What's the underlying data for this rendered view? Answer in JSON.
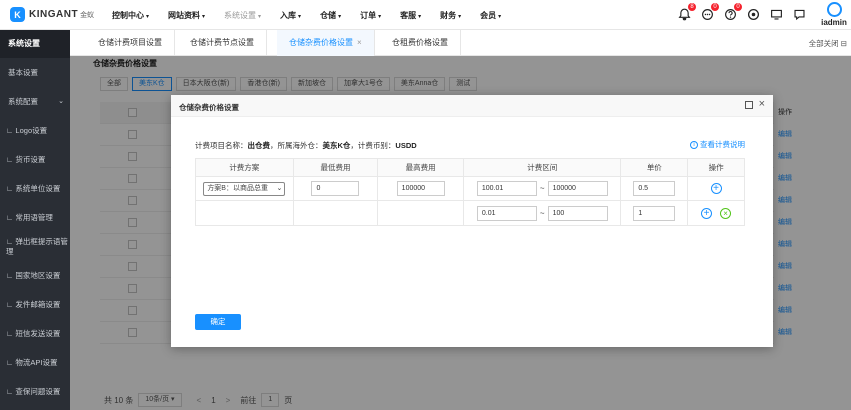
{
  "app": {
    "logo_mark": "K",
    "logo_text": "KINGANT",
    "logo_sub": "金蚁",
    "user_name": "iadmin"
  },
  "topnav": [
    {
      "label": "控制中心",
      "caret": "▾",
      "muted": false
    },
    {
      "label": "网站资料",
      "caret": "▾",
      "muted": false
    },
    {
      "label": "系统设置",
      "caret": "▾",
      "muted": true
    },
    {
      "label": "入库",
      "caret": "▾",
      "muted": false
    },
    {
      "label": "仓储",
      "caret": "▾",
      "muted": false
    },
    {
      "label": "订单",
      "caret": "▾",
      "muted": false
    },
    {
      "label": "客服",
      "caret": "▾",
      "muted": false
    },
    {
      "label": "财务",
      "caret": "▾",
      "muted": false
    },
    {
      "label": "会员",
      "caret": "▾",
      "muted": false
    }
  ],
  "top_icons": [
    {
      "name": "bell-icon",
      "badge": "8"
    },
    {
      "name": "message-icon",
      "badge": "0"
    },
    {
      "name": "help-icon",
      "badge": "0"
    },
    {
      "name": "target-icon",
      "badge": ""
    },
    {
      "name": "monitor-icon",
      "badge": ""
    },
    {
      "name": "chat-icon",
      "badge": ""
    }
  ],
  "sidebar": {
    "header": "系统设置",
    "items": [
      {
        "label": "基本设置",
        "sub": false
      },
      {
        "label": "系统配置",
        "sub": false,
        "arrow": "⌄"
      },
      {
        "label": "∟ Logo设置",
        "sub": true
      },
      {
        "label": "∟ 货币设置",
        "sub": true
      },
      {
        "label": "∟ 系统单位设置",
        "sub": true
      },
      {
        "label": "∟ 常用语管理",
        "sub": true
      },
      {
        "label": "∟ 弹出框提示语管理",
        "sub": true
      },
      {
        "label": "∟ 国家地区设置",
        "sub": true
      },
      {
        "label": "∟ 发件邮箱设置",
        "sub": true
      },
      {
        "label": "∟ 短信发送设置",
        "sub": true
      },
      {
        "label": "∟ 物流API设置",
        "sub": true
      },
      {
        "label": "∟ 查保问题设置",
        "sub": true
      }
    ]
  },
  "tabs": [
    {
      "label": "仓储计费项目设置",
      "active": false
    },
    {
      "label": "仓储计费节点设置",
      "active": false
    },
    {
      "label": "仓储杂费价格设置",
      "active": true,
      "close": "×"
    },
    {
      "label": "仓租费价格设置",
      "active": false
    }
  ],
  "close_all": "全部关闭 ⊟",
  "content": {
    "title": "仓储杂费价格设置",
    "warehouse_tabs": [
      "全部",
      "美东K仓",
      "日本大阪仓(新)",
      "香港仓(新)",
      "新加坡仓",
      "加拿大1号仓",
      "美东Anna仓",
      "测试"
    ],
    "active_warehouse": 1,
    "ops_header": "操作",
    "ops_link": "编辑",
    "pager": {
      "total": "共 10 条",
      "per_page": "10条/页 ▾",
      "prev": "<",
      "page": "1",
      "next": ">",
      "goto": "前往",
      "goto_page": "1",
      "unit": "页"
    }
  },
  "dialog": {
    "title": "仓储杂费价格设置",
    "info_prefix_1": "计费项目名称：",
    "info_value_1": "出仓费",
    "info_prefix_2": "，所属海外仓：",
    "info_value_2": "美东K仓",
    "info_prefix_3": "，计费币别：",
    "info_value_3": "USDD",
    "help_link": "查看计费说明",
    "columns": [
      "计费方案",
      "最低费用",
      "最高费用",
      "计费区间",
      "单价",
      "操作"
    ],
    "rows": [
      {
        "scheme": "方案B：以商品总重",
        "min_fee": "0",
        "max_fee": "100000",
        "range_from": "100.01",
        "range_to": "100000",
        "price": "0.5"
      },
      {
        "scheme": "",
        "min_fee": "",
        "max_fee": "",
        "range_from": "0.01",
        "range_to": "100",
        "price": "1"
      }
    ],
    "tilde": "~",
    "confirm": "确定"
  }
}
